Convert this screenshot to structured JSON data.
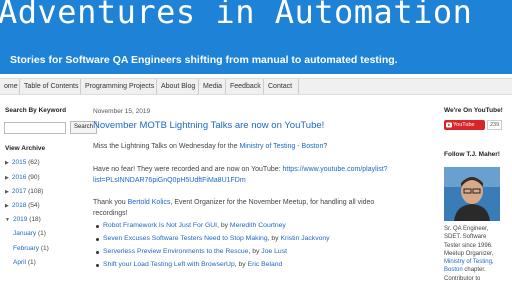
{
  "header": {
    "title": "Adventures in Automation",
    "description": "Stories for Software QA Engineers shifting from manual to automated testing."
  },
  "nav": [
    "ome",
    "Table of Contents",
    "Programming Projects",
    "About Blog",
    "Media",
    "Feedback",
    "Contact"
  ],
  "left_sidebar": {
    "search_heading": "Search By Keyword",
    "search_button": "Search",
    "search_value": "",
    "archive_heading": "View Archive",
    "years": [
      {
        "year": "2015",
        "count": "(62)"
      },
      {
        "year": "2016",
        "count": "(90)"
      },
      {
        "year": "2017",
        "count": "(108)"
      },
      {
        "year": "2018",
        "count": "(54)"
      },
      {
        "year": "2019",
        "count": "(18)"
      }
    ],
    "months": [
      {
        "month": "January",
        "count": "(1)"
      },
      {
        "month": "February",
        "count": "(1)"
      },
      {
        "month": "April",
        "count": "(1)"
      }
    ]
  },
  "post": {
    "date": "November 15, 2019",
    "title": "November MOTB Lightning Talks are now on YouTube!",
    "p1_prefix": "Miss the Lightning Talks on Wednesday for the ",
    "p1_link": "Ministry of Testing - Boston",
    "p1_suffix": "?",
    "p2_prefix": "Have no fear! They were recorded and are now on YouTube: ",
    "p2_link_a": "https://www.youtube.com/playlist?",
    "p2_link_b": "list=PLsINNDAR76piGnQ0pH5UdftFiMa8U1FDm",
    "p3_prefix": "Thank you ",
    "p3_link": "Bertold Kolics",
    "p3_suffix_a": ", Event Organizer for the November Meetup, for handling all video",
    "p3_suffix_b": "recordings!",
    "bullets": [
      {
        "title": "Robot Framework Is Not Just For GUI",
        "by": ", by ",
        "author": "Meredith Courtney"
      },
      {
        "title": "Seven Excuses Software Testers Need to Stop Making",
        "by": ", by ",
        "author": "Kristin Jackvony"
      },
      {
        "title": "Serverless Preview Environments to the Rescue",
        "by": ", by ",
        "author": "Joe Lust"
      },
      {
        "title": "Shift your Load Testing Left with BrowserUp",
        "by": ", by ",
        "author": "Eric Beland"
      }
    ]
  },
  "right_sidebar": {
    "youtube_heading": "We're On YouTube!",
    "youtube_label": "YouTube",
    "youtube_count": "239",
    "follow_heading": "Follow T.J. Maher!",
    "bio_line1": "Sr. QA Engineer,",
    "bio_line2": "SDET. Software",
    "bio_line3": "Tester since 1996.",
    "bio_line4": "Meetup Organizer,",
    "bio_link1": "Ministry of Testing,",
    "bio_link2": "Boston",
    "bio_line5": " chapter.",
    "bio_line6": "Contributor to"
  },
  "colors": {
    "header_bg": "#1e82d6",
    "link": "#1e66c8",
    "youtube_red": "#d9252a"
  }
}
